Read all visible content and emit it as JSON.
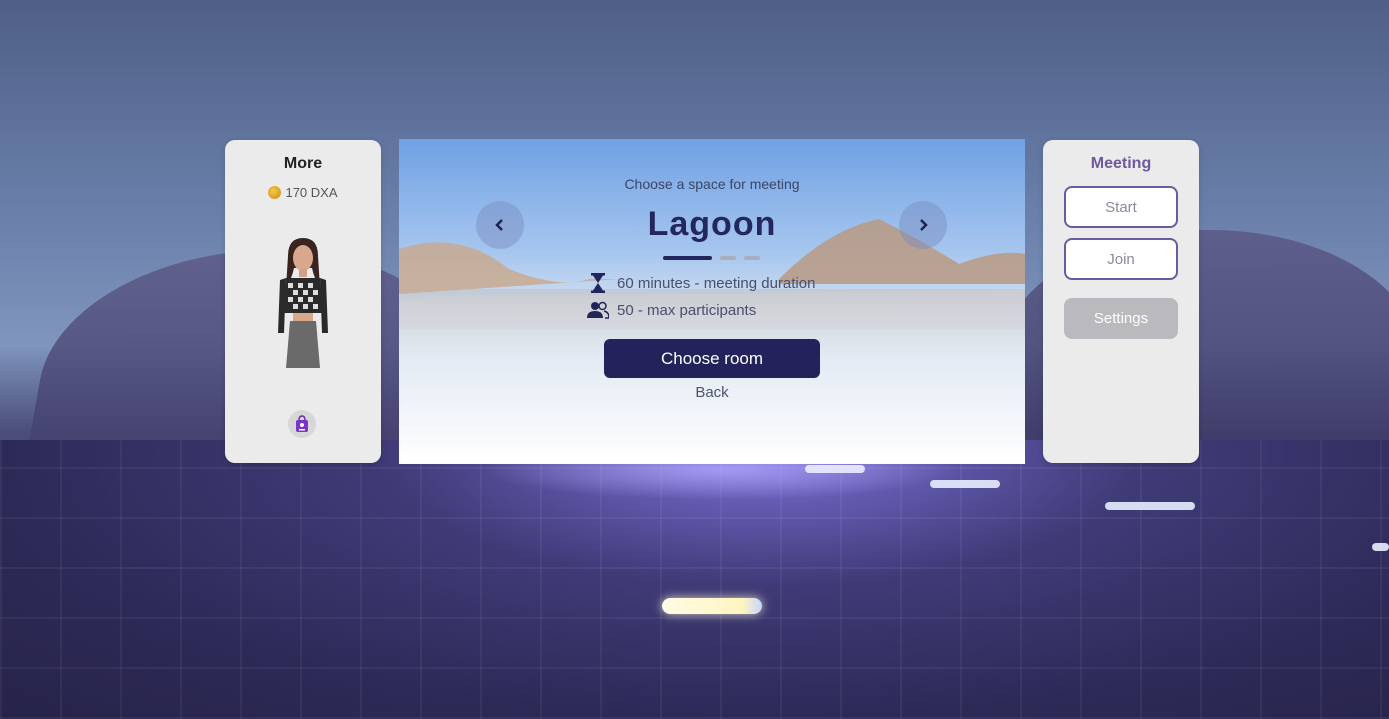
{
  "more_panel": {
    "title": "More",
    "balance": "170 DXA",
    "coin_icon": "coin-icon",
    "avatar_icon": "avatar-figure",
    "bag_icon": "shopping-bag-icon"
  },
  "room_selector": {
    "subtitle": "Choose a space for meeting",
    "room_name": "Lagoon",
    "pages": 3,
    "active_page": 1,
    "duration": "60 minutes - meeting duration",
    "participants": "50 - max participants",
    "choose_button": "Choose room",
    "back_link": "Back",
    "prev_icon": "chevron-left-icon",
    "next_icon": "chevron-right-icon",
    "duration_icon": "hourglass-icon",
    "participants_icon": "people-icon"
  },
  "meeting_panel": {
    "title": "Meeting",
    "start_button": "Start",
    "join_button": "Join",
    "settings_button": "Settings"
  },
  "colors": {
    "accent": "#24265e",
    "meeting_accent": "#6b5a9e",
    "panel_bg": "#ebebeb"
  }
}
